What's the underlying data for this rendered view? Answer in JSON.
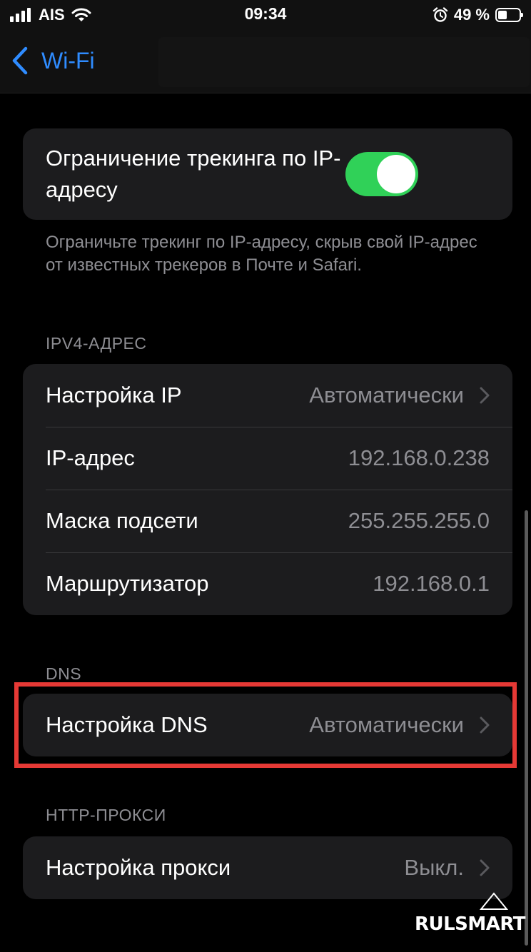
{
  "status_bar": {
    "carrier": "AIS",
    "time": "09:34",
    "battery_percent": "49 %",
    "battery_level": 0.49,
    "icons": [
      "signal-icon",
      "wifi-icon",
      "alarm-icon",
      "battery-icon"
    ]
  },
  "nav": {
    "back_label": "Wi-Fi"
  },
  "tracking": {
    "label": "Ограничение трекинга по IP-адресу",
    "enabled": true,
    "footer": "Ограничьте трекинг по IP-адресу, скрыв свой IP-адрес от известных трекеров в Почте и Safari."
  },
  "ipv4": {
    "header": "IPV4-АДРЕС",
    "rows": [
      {
        "label": "Настройка IP",
        "value": "Автоматически"
      },
      {
        "label": "IP-адрес",
        "value": "192.168.0.238"
      },
      {
        "label": "Маска подсети",
        "value": "255.255.255.0"
      },
      {
        "label": "Маршрутизатор",
        "value": "192.168.0.1"
      }
    ]
  },
  "dns": {
    "header": "DNS",
    "row": {
      "label": "Настройка DNS",
      "value": "Автоматически"
    }
  },
  "proxy": {
    "header": "HTTP-ПРОКСИ",
    "row": {
      "label": "Настройка прокси",
      "value": "Выкл."
    }
  },
  "watermark": "RULSMART",
  "colors": {
    "accent": "#2f8cff",
    "toggle_on": "#30d158",
    "highlight": "#e53935",
    "card": "#1c1c1e",
    "secondary_text": "#8e8e93"
  }
}
